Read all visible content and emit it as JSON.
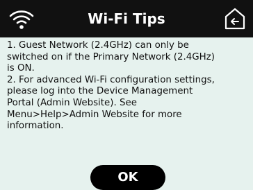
{
  "header": {
    "title": "Wi-Fi Tips",
    "left_icon": "wifi-icon",
    "right_icon": "home-back-icon"
  },
  "content": {
    "line1": "1. Guest Network (2.4GHz) can only be",
    "line2": "switched on if the Primary Network (2.4GHz)",
    "line3": "is ON.",
    "line4": "2. For advanced Wi-Fi configuration settings,",
    "line5": "please log into the Device Management",
    "line6": "Portal (Admin Website). See",
    "line7": "Menu>Help>Admin Website for more",
    "line8": "information."
  },
  "buttons": {
    "ok_label": "OK"
  },
  "colors": {
    "header_bg": "#111111",
    "body_bg": "#e6f2ee",
    "button_bg": "#000000",
    "text": "#111111"
  }
}
